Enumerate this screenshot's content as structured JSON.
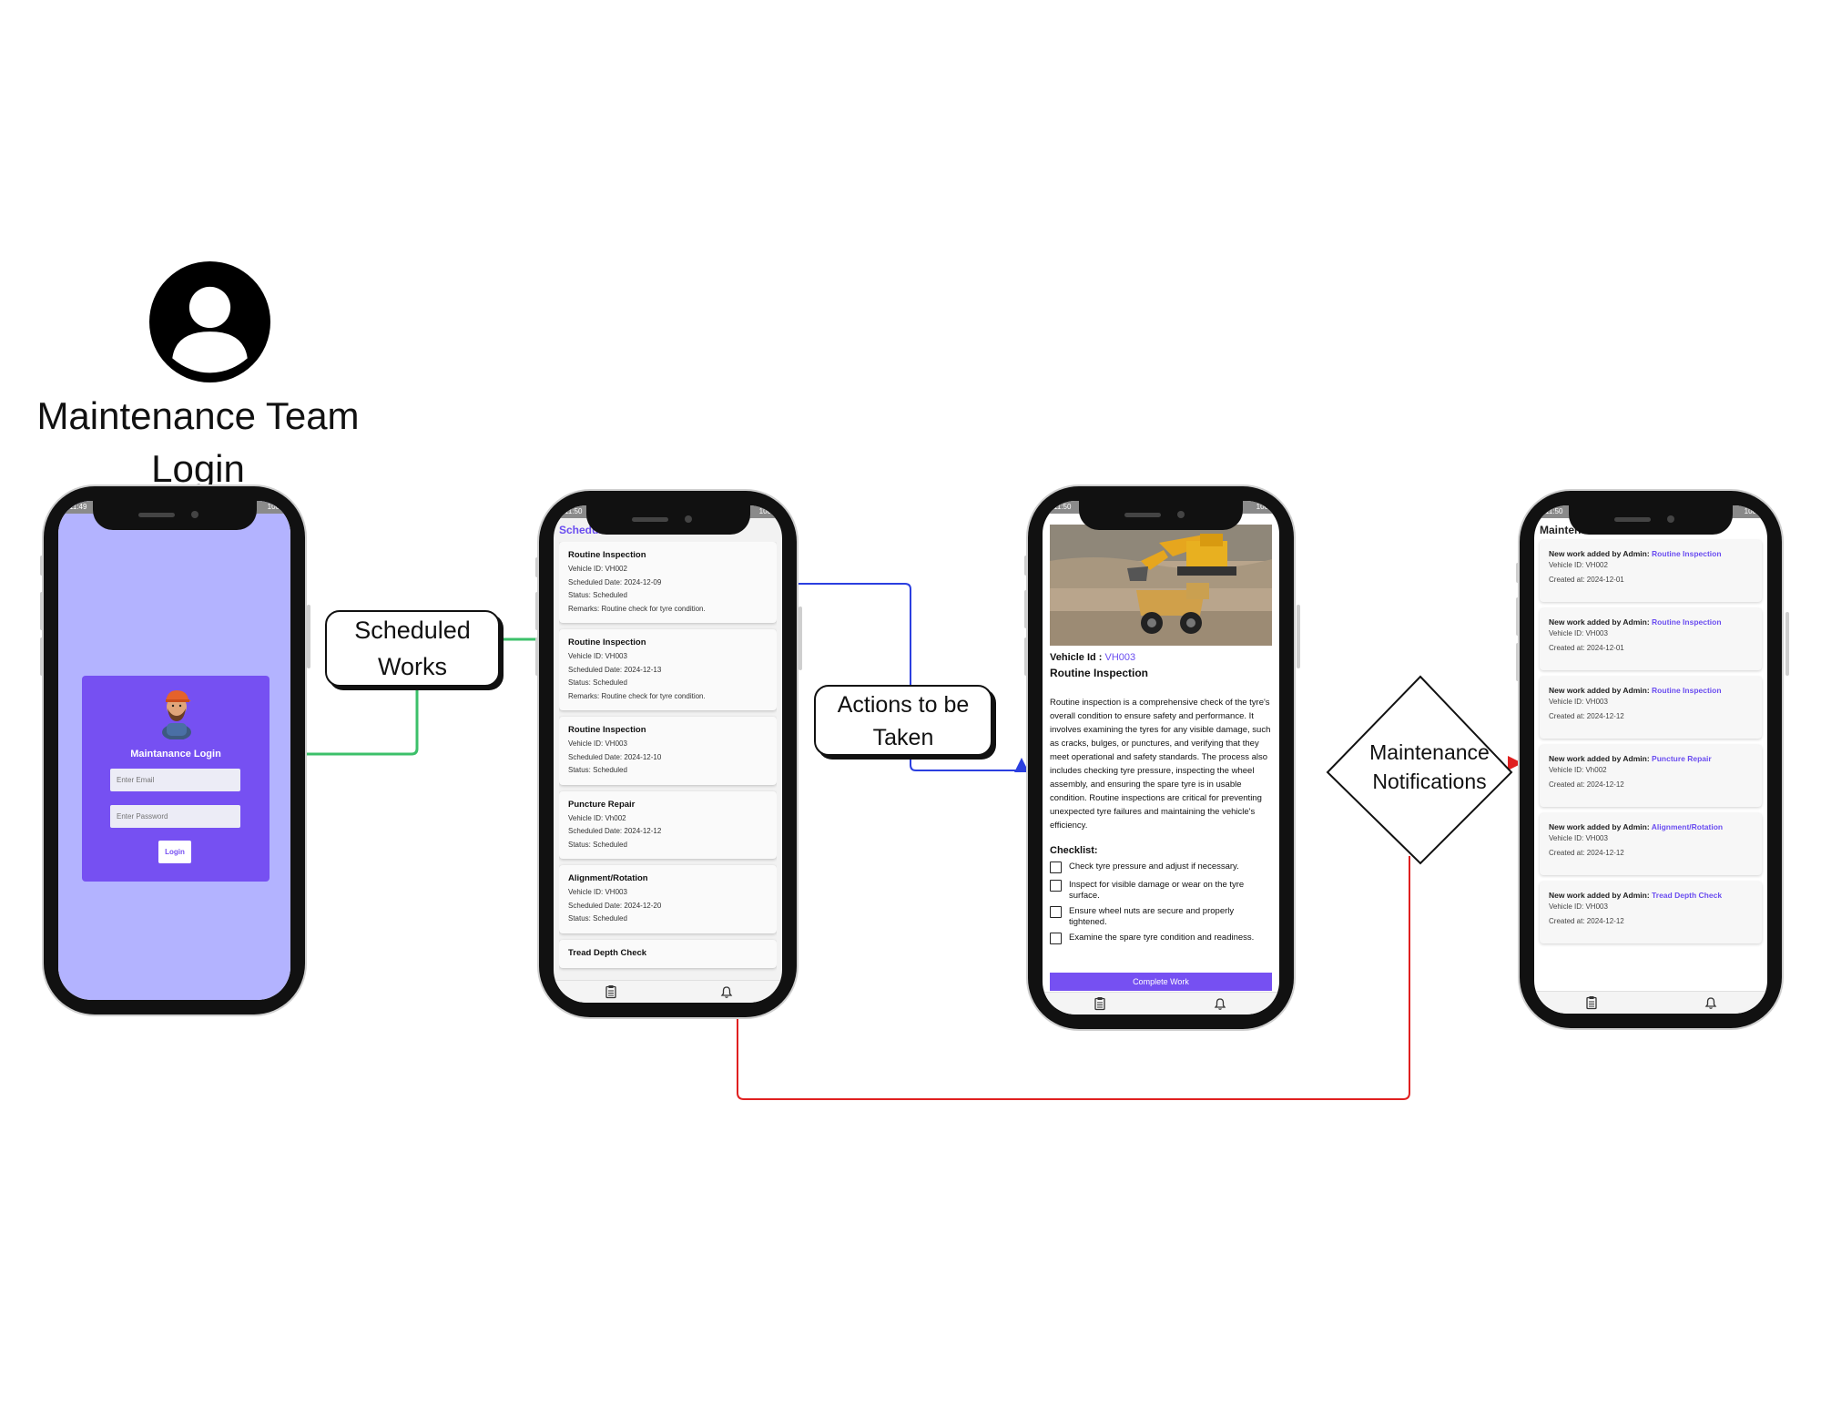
{
  "title": {
    "line1": "Maintenance Team",
    "line2": "Login"
  },
  "labels": {
    "scheduled": {
      "line1": "Scheduled",
      "line2": "Works"
    },
    "actions": {
      "line1": "Actions to be",
      "line2": "Taken"
    },
    "notifications": {
      "line1": "Maintenance",
      "line2": "Notifications"
    }
  },
  "colors": {
    "accent": "#7650F2",
    "login_bg": "#B3B3FF",
    "green_arrow": "#3CC06A",
    "blue_arrow": "#2B3FE0",
    "red_arrow": "#E02020"
  },
  "login": {
    "status_time": "11:49",
    "status_batt": "100",
    "title": "Maintanance Login",
    "email_placeholder": "Enter Email",
    "password_placeholder": "Enter Password",
    "button": "Login"
  },
  "scheduled": {
    "status_time": "11:50",
    "status_batt": "100",
    "heading": "Scheduled Works",
    "items": [
      {
        "title": "Routine Inspection",
        "vehicle": "Vehicle ID: VH002",
        "date": "Scheduled Date: 2024-12-09",
        "status": "Status: Scheduled",
        "remarks": "Remarks: Routine check for tyre condition."
      },
      {
        "title": "Routine Inspection",
        "vehicle": "Vehicle ID: VH003",
        "date": "Scheduled Date: 2024-12-13",
        "status": "Status: Scheduled",
        "remarks": "Remarks: Routine check for tyre condition."
      },
      {
        "title": "Routine Inspection",
        "vehicle": "Vehicle ID: VH003",
        "date": "Scheduled Date: 2024-12-10",
        "status": "Status: Scheduled"
      },
      {
        "title": "Puncture Repair",
        "vehicle": "Vehicle ID: Vh002",
        "date": "Scheduled Date: 2024-12-12",
        "status": "Status: Scheduled"
      },
      {
        "title": "Alignment/Rotation",
        "vehicle": "Vehicle ID: VH003",
        "date": "Scheduled Date: 2024-12-20",
        "status": "Status: Scheduled"
      },
      {
        "title": "Tread Depth Check"
      }
    ]
  },
  "detail": {
    "status_time": "11:50",
    "status_batt": "100",
    "vehicle_label": "Vehicle Id : ",
    "vehicle_id": "VH003",
    "title": "Routine Inspection",
    "description": "Routine inspection is a comprehensive check of the tyre's overall condition to ensure safety and performance. It involves examining the tyres for any visible damage, such as cracks, bulges, or punctures, and verifying that they meet operational and safety standards. The process also includes checking tyre pressure, inspecting the wheel assembly, and ensuring the spare tyre is in usable condition. Routine inspections are critical for preventing unexpected tyre failures and maintaining the vehicle's efficiency.",
    "checklist_heading": "Checklist:",
    "checklist": [
      "Check tyre pressure and adjust if necessary.",
      "Inspect for visible damage or wear on the tyre surface.",
      "Ensure wheel nuts are secure and properly tightened.",
      "Examine the spare tyre condition and readiness."
    ],
    "button": "Complete Work"
  },
  "notifications": {
    "status_time": "11:50",
    "status_batt": "100",
    "heading": "Maintenance Notifications",
    "prefix": "New work added by Admin: ",
    "items": [
      {
        "work": "Routine Inspection",
        "vehicle": "Vehicle ID: VH002",
        "created": "Created at: 2024-12-01"
      },
      {
        "work": "Routine Inspection",
        "vehicle": "Vehicle ID: VH003",
        "created": "Created at: 2024-12-01"
      },
      {
        "work": "Routine Inspection",
        "vehicle": "Vehicle ID: VH003",
        "created": "Created at: 2024-12-12"
      },
      {
        "work": "Puncture Repair",
        "vehicle": "Vehicle ID: Vh002",
        "created": "Created at: 2024-12-12"
      },
      {
        "work": "Alignment/Rotation",
        "vehicle": "Vehicle ID: VH003",
        "created": "Created at: 2024-12-12"
      },
      {
        "work": "Tread Depth Check",
        "vehicle": "Vehicle ID: VH003",
        "created": "Created at: 2024-12-12"
      }
    ]
  }
}
